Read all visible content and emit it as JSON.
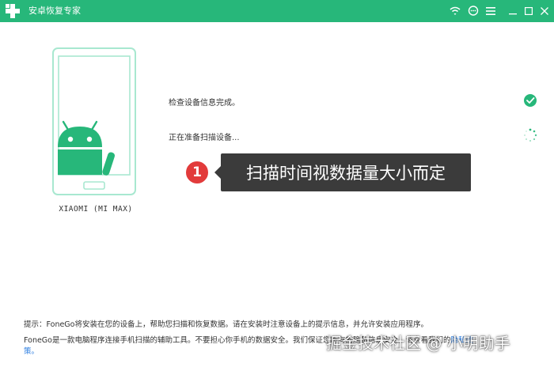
{
  "window": {
    "title": "安卓恢复专家",
    "accent_color": "#27b77a",
    "controls": [
      "wifi-icon",
      "feedback-icon",
      "menu-icon",
      "minimize-icon",
      "maximize-icon",
      "close-icon"
    ]
  },
  "device": {
    "name": "XIAOMI (MI MAX)",
    "icon": "android-robot-icon",
    "phone_color": "#a8e8d0",
    "robot_color": "#27b77a"
  },
  "steps": [
    {
      "label": "检查设备信息完成。",
      "status": "done",
      "icon": "check-circle-icon"
    },
    {
      "label": "正在准备扫描设备...",
      "status": "loading",
      "icon": "spinner-icon"
    }
  ],
  "tooltip": {
    "number": "1",
    "text": "扫描时间视数据量大小而定"
  },
  "hint": "提示：FoneGo将安装在您的设备上，帮助您扫描和恢复数据。请在安装时注意设备上的提示信息，并允许安装应用程序。",
  "note": {
    "text": "FoneGo是一款电脑程序连接手机扫描的辅助工具。不要担心你手机的数据安全。我们保证您所有的隐私信息安全，请查看我们的",
    "link_tail": "隐私政",
    "link_wrap": "策。"
  },
  "watermark": "掘金技术社区 @ 小明助手"
}
